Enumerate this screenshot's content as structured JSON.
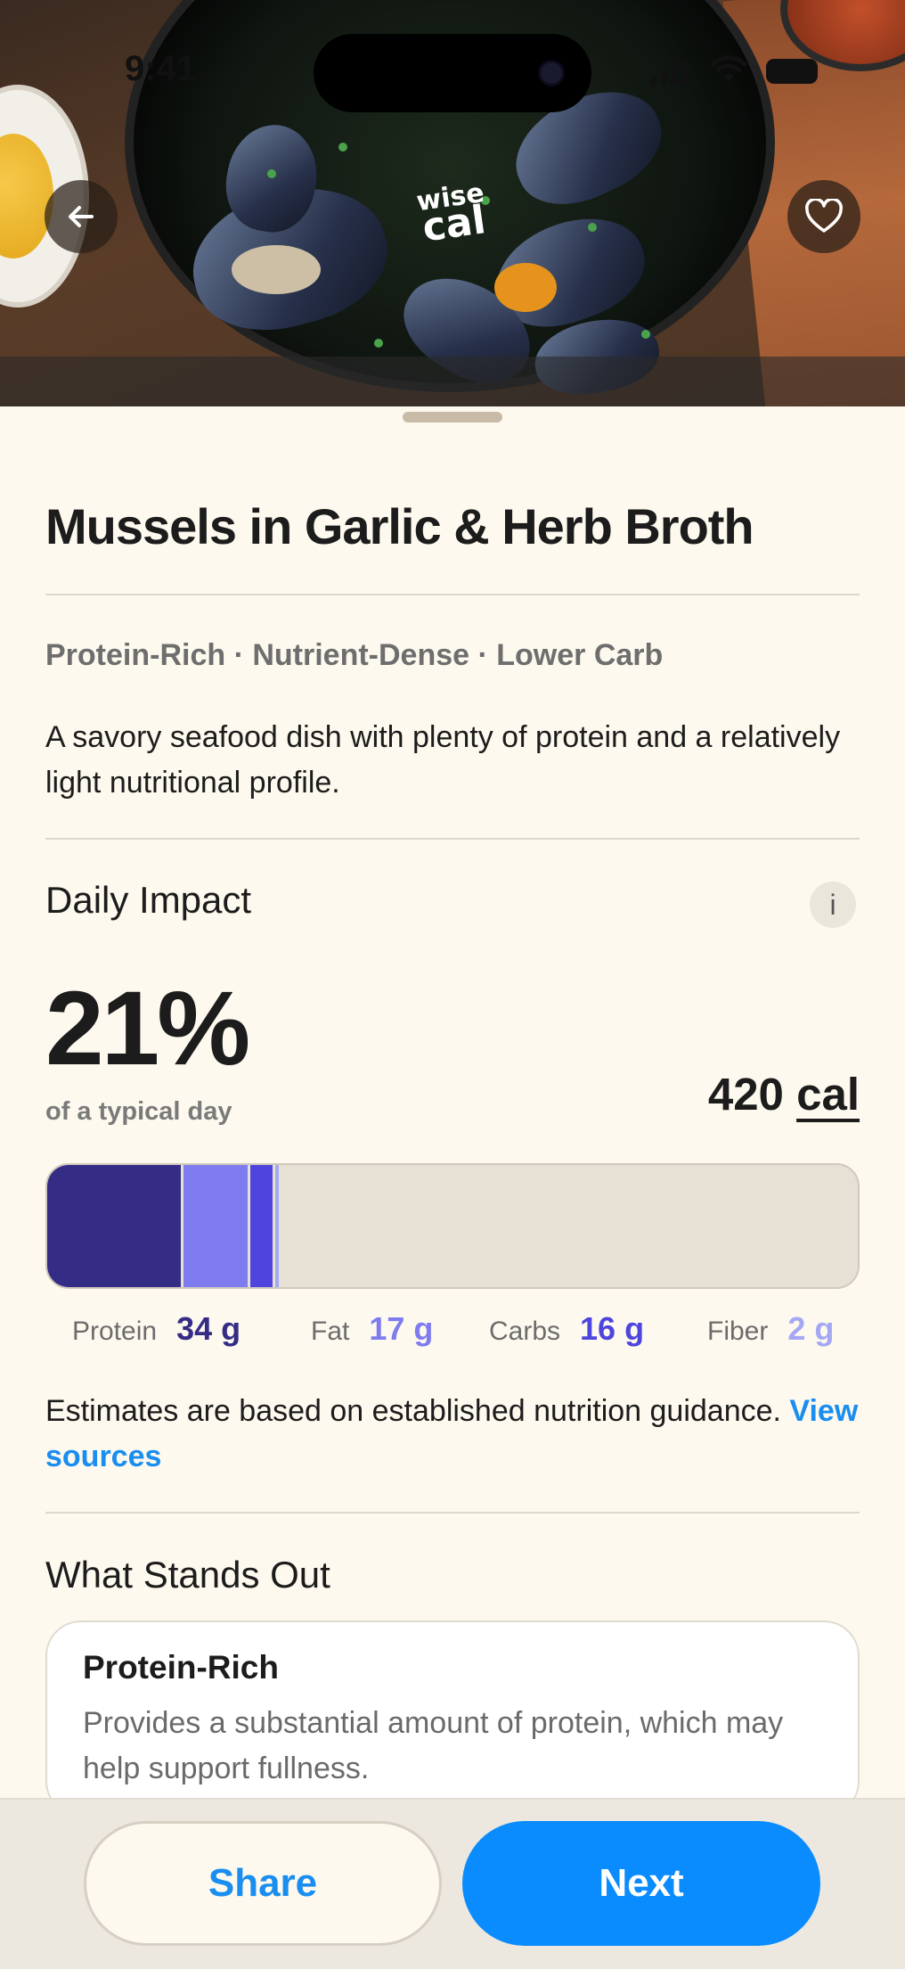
{
  "status_bar": {
    "time": "9:41"
  },
  "hero": {
    "logo_line1": "wise",
    "logo_line2": "cal"
  },
  "recipe": {
    "title": "Mussels in Garlic & Herb Broth",
    "tags": "Protein-Rich · Nutrient-Dense · Lower Carb",
    "description": "A savory seafood dish with plenty of protein and a relatively light nutritional profile."
  },
  "daily_impact": {
    "heading": "Daily Impact",
    "info_label": "i",
    "percent": "21%",
    "percent_caption": "of a typical day",
    "calories_value": "420",
    "calories_unit": "cal",
    "macros": [
      {
        "label": "Protein",
        "value": "34 g",
        "color": "#352c86",
        "fraction": 0.168
      },
      {
        "label": "Fat",
        "value": "17 g",
        "color": "#7f7cef",
        "fraction": 0.082
      },
      {
        "label": "Carbs",
        "value": "16 g",
        "color": "#4e45de",
        "fraction": 0.031
      },
      {
        "label": "Fiber",
        "value": "2 g",
        "color": "#a4a8f4",
        "fraction": 0.004
      }
    ],
    "estimate_text": "Estimates are based on established nutrition guidance.",
    "sources_link": "View sources"
  },
  "stands_out": {
    "heading": "What Stands Out",
    "cards": [
      {
        "title": "Protein-Rich",
        "desc": "Provides a substantial amount of protein, which may help support fullness."
      }
    ]
  },
  "actions": {
    "share_label": "Share",
    "next_label": "Next"
  }
}
